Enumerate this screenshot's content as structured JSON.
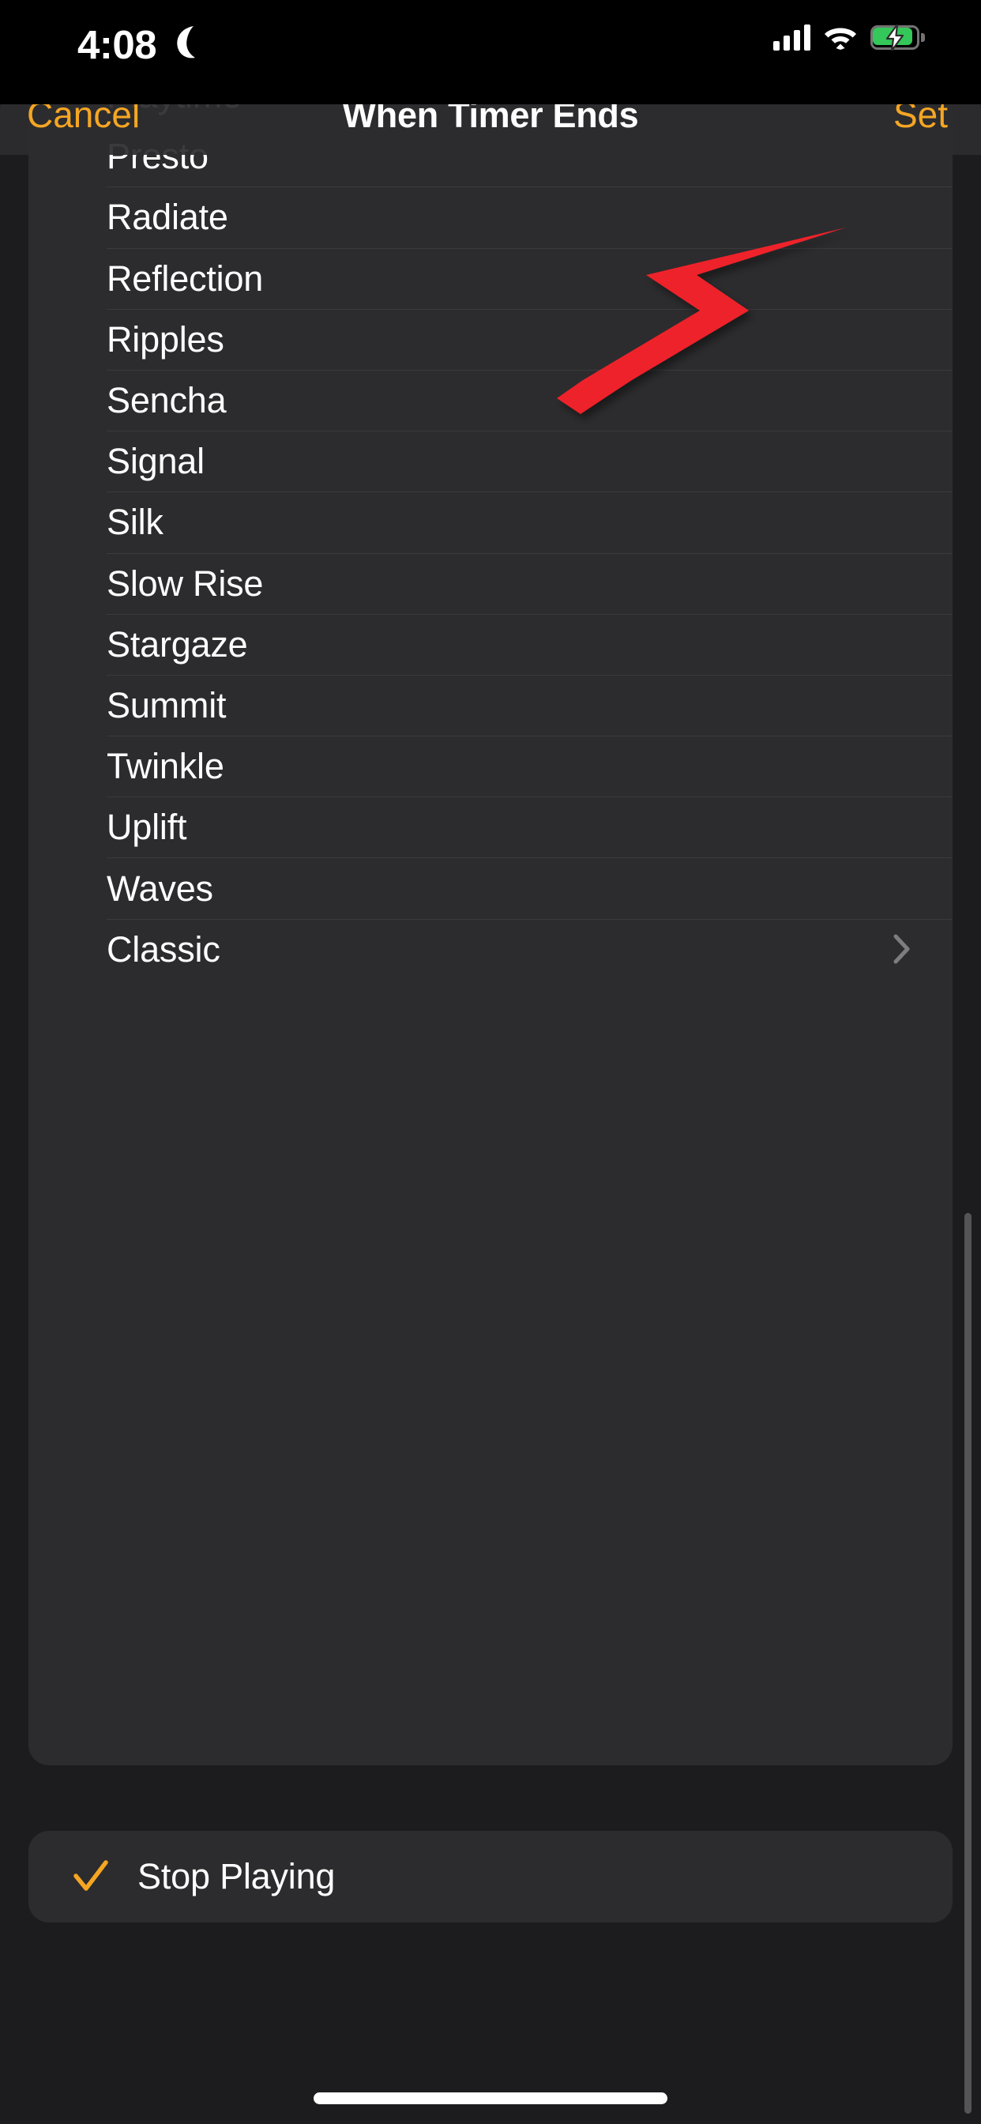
{
  "status_bar": {
    "time": "4:08",
    "dnd_icon": "crescent-moon-icon",
    "cellular_icon": "signal-bars-icon",
    "wifi_icon": "wifi-icon",
    "battery_icon": "battery-charging-icon",
    "battery_color": "#34c759"
  },
  "nav": {
    "cancel_label": "Cancel",
    "title": "When Timer Ends",
    "set_label": "Set",
    "accent_color": "#f5a623"
  },
  "tones": {
    "items": [
      {
        "label": "Playtime",
        "chevron": false
      },
      {
        "label": "Presto",
        "chevron": false
      },
      {
        "label": "Radiate",
        "chevron": false
      },
      {
        "label": "Reflection",
        "chevron": false
      },
      {
        "label": "Ripples",
        "chevron": false
      },
      {
        "label": "Sencha",
        "chevron": false
      },
      {
        "label": "Signal",
        "chevron": false
      },
      {
        "label": "Silk",
        "chevron": false
      },
      {
        "label": "Slow Rise",
        "chevron": false
      },
      {
        "label": "Stargaze",
        "chevron": false
      },
      {
        "label": "Summit",
        "chevron": false
      },
      {
        "label": "Twinkle",
        "chevron": false
      },
      {
        "label": "Uplift",
        "chevron": false
      },
      {
        "label": "Waves",
        "chevron": false
      },
      {
        "label": "Classic",
        "chevron": true
      }
    ]
  },
  "action_section": {
    "items": [
      {
        "label": "Stop Playing",
        "selected": true,
        "check_icon": "checkmark-icon"
      }
    ]
  },
  "annotation": {
    "arrow_icon": "red-arrow-icon",
    "color": "#ee2229",
    "points_to": "Set"
  },
  "colors": {
    "page_background": "#1c1c1e",
    "card_background": "#2c2c2e",
    "separator": "#3b3b3d",
    "text_primary": "#ffffff",
    "accent": "#f5a623",
    "scroll_indicator": "#545457"
  }
}
